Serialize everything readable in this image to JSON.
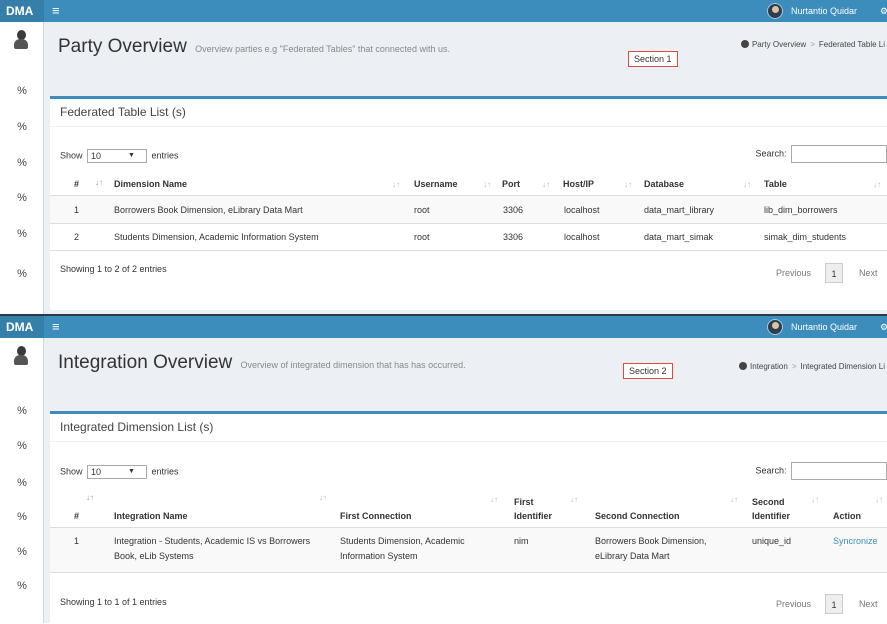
{
  "section1": {
    "brand": "DMA",
    "user_name": "Nurtantio Quidar",
    "page_title": "Party Overview",
    "page_subtitle": "Overview parties e.g \"Federated Tables\" that connected with us.",
    "section_tag": "Section 1",
    "breadcrumb": [
      "Party Overview",
      "Federated Table Li"
    ],
    "box_title": "Federated Table List (s)",
    "length": {
      "show": "Show",
      "value": "10",
      "entries": "entries"
    },
    "search_label": "Search:",
    "columns": [
      "#",
      "Dimension Name",
      "Username",
      "Port",
      "Host/IP",
      "Database",
      "Table"
    ],
    "rows": [
      [
        "1",
        "Borrowers Book Dimension, eLibrary Data Mart",
        "root",
        "3306",
        "localhost",
        "data_mart_library",
        "lib_dim_borrowers"
      ],
      [
        "2",
        "Students Dimension, Academic Information System",
        "root",
        "3306",
        "localhost",
        "data_mart_simak",
        "simak_dim_students"
      ]
    ],
    "info": "Showing 1 to 2 of 2 entries",
    "pagination": {
      "previous": "Previous",
      "page": "1",
      "next": "Next"
    }
  },
  "section2": {
    "brand": "DMA",
    "user_name": "Nurtantio Quidar",
    "page_title": "Integration Overview",
    "page_subtitle": "Overview of integrated dimension that has has occurred.",
    "section_tag": "Section 2",
    "breadcrumb": [
      "Integration",
      "Integrated Dimension Li"
    ],
    "box_title": "Integrated Dimension List (s)",
    "length": {
      "show": "Show",
      "value": "10",
      "entries": "entries"
    },
    "search_label": "Search:",
    "columns": {
      "num": "#",
      "integration_name": "Integration Name",
      "first_connection": "First Connection",
      "first_identifier": [
        "First",
        "Identifier"
      ],
      "second_connection": "Second Connection",
      "second_identifier": [
        "Second",
        "Identifier"
      ],
      "action": "Action"
    },
    "row": {
      "num": "1",
      "integration_name": [
        "Integration - Students, Academic IS vs Borrowers",
        "Book, eLib Systems"
      ],
      "first_connection": [
        "Students Dimension, Academic",
        "Information System"
      ],
      "first_identifier": "nim",
      "second_connection": [
        "Borrowers Book Dimension,",
        "eLibrary Data Mart"
      ],
      "second_identifier": "unique_id",
      "action": "Syncronize"
    },
    "info": "Showing 1 to 1 of 1 entries",
    "pagination": {
      "previous": "Previous",
      "page": "1",
      "next": "Next"
    }
  },
  "colors": {
    "topbar": "#3c8dbc",
    "brand": "#367fa9",
    "section_tag_border": "#dd4b39",
    "content_bg": "#ecf0f5",
    "link": "#3c8dbc"
  },
  "icons": {
    "menu": "hamburger-icon",
    "sidebar_nav": "link-icon",
    "breadcrumb": "dashboard-icon",
    "avatar": "user-avatar"
  }
}
